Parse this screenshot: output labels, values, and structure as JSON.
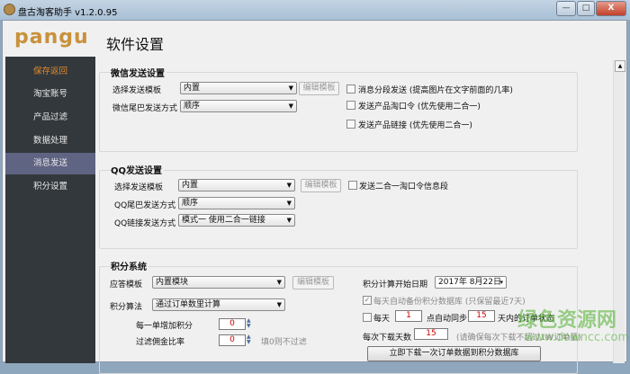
{
  "window": {
    "title": "盘古淘客助手 v1.2.0.95",
    "min": "—",
    "max": "□",
    "close": "X"
  },
  "logo": "pangu",
  "header": {
    "title": "软件设置"
  },
  "sidebar": {
    "items": [
      {
        "label": "保存返回"
      },
      {
        "label": "淘宝账号"
      },
      {
        "label": "产品过滤"
      },
      {
        "label": "数据处理"
      },
      {
        "label": "消息发送"
      },
      {
        "label": "积分设置"
      }
    ],
    "selected": "消息发送"
  },
  "wechat": {
    "title": "微信发送设置",
    "template_label": "选择发送模板",
    "template_value": "内置",
    "edit_btn": "编辑模板",
    "tail_label": "微信尾巴发送方式",
    "tail_value": "顺序",
    "cb1": "消息分段发送  (提高图片在文字前面的几率)",
    "cb2": "发送产品淘口令  (优先使用二合一)",
    "cb3": "发送产品链接     (优先使用二合一)"
  },
  "qq": {
    "title": "QQ发送设置",
    "template_label": "选择发送模板",
    "template_value": "内置",
    "edit_btn": "编辑模板",
    "cb1": "发送二合一淘口令信息段",
    "tail_label": "QQ尾巴发送方式",
    "tail_value": "顺序",
    "link_label": "QQ链接发送方式",
    "link_value": "模式一  使用二合一链接"
  },
  "points": {
    "title": "积分系统",
    "reply_label": "应答模板",
    "reply_value": "内置模块",
    "edit_btn": "编辑模板",
    "algo_label": "积分算法",
    "algo_value": "通过订单数里计算",
    "per_order_label": "每一单增加积分",
    "per_order_value": "0",
    "filter_label": "过滤佣金比率",
    "filter_value": "0",
    "filter_hint": "填0则不过滤",
    "start_date_label": "积分计算开始日期",
    "start_date_value": "2017年 8月22日",
    "backup_cb": "每天自动备份积分数据库 (只保留最近7天)",
    "daily_prefix": "每天",
    "daily_hour": "1",
    "daily_mid": "点自动同步",
    "daily_days": "15",
    "daily_suffix": "天内的订单状态",
    "download_label": "每次下载天数",
    "download_value": "15",
    "download_hint": "(请确保每次下载不超过1W订单量)",
    "download_btn": "立即下载一次订单数据到积分数据库"
  },
  "watermark": {
    "line1": "绿色资源网",
    "line2": "www.downcc.com"
  }
}
